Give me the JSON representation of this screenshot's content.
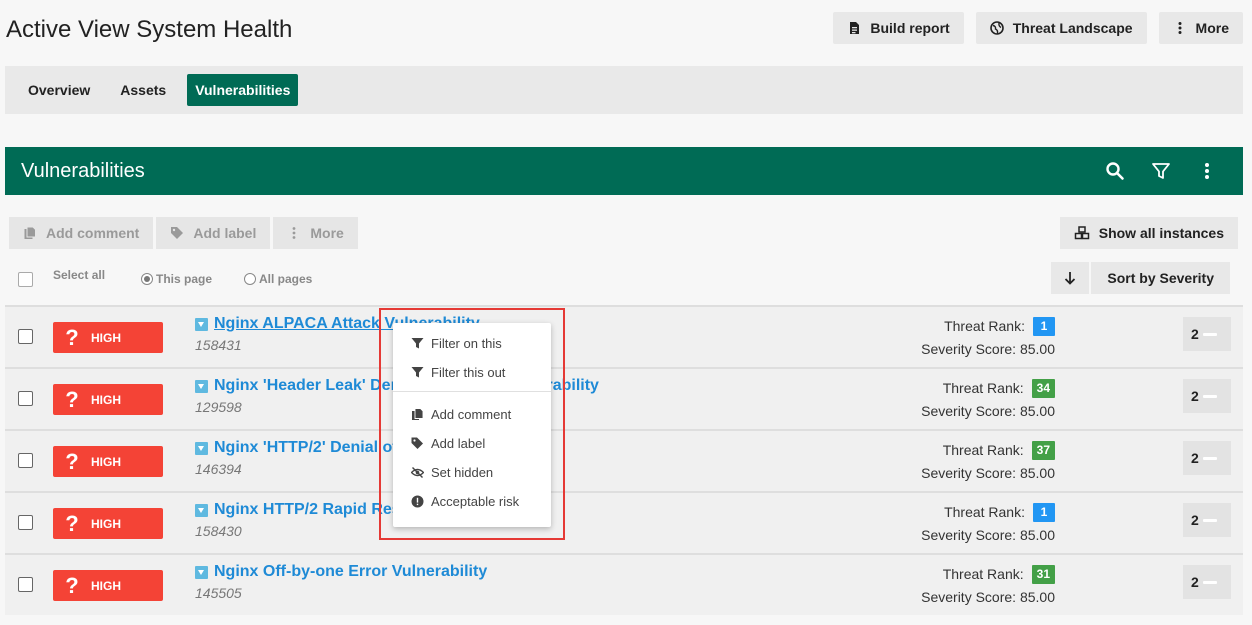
{
  "page": {
    "title": "Active View System Health"
  },
  "top_actions": {
    "build_report": "Build report",
    "threat_landscape": "Threat Landscape",
    "more": "More"
  },
  "tabs": [
    {
      "label": "Overview",
      "active": false
    },
    {
      "label": "Assets",
      "active": false
    },
    {
      "label": "Vulnerabilities",
      "active": true
    }
  ],
  "section": {
    "title": "Vulnerabilities"
  },
  "toolbar": {
    "add_comment": "Add comment",
    "add_label": "Add label",
    "more": "More",
    "show_all": "Show all instances"
  },
  "selection": {
    "select_all": "Select all",
    "this_page": "This page",
    "all_pages": "All pages",
    "this_page_selected": true
  },
  "sort": {
    "label": "Sort by Severity",
    "direction": "descending"
  },
  "labels": {
    "threat_rank": "Threat Rank:",
    "severity_prefix": "Severity Score:"
  },
  "vulnerabilities": [
    {
      "severity": "HIGH",
      "title": "Nginx ALPACA Attack Vulnerability",
      "id": "158431",
      "threat_rank": "1",
      "rank_color": "#2196f3",
      "severity_score": "85.00",
      "count": "2"
    },
    {
      "severity": "HIGH",
      "title": "Nginx 'Header Leak' Denial of Service Vulnerability",
      "id": "129598",
      "threat_rank": "34",
      "rank_color": "#43a047",
      "severity_score": "85.00",
      "count": "2"
    },
    {
      "severity": "HIGH",
      "title": "Nginx 'HTTP/2' Denial of",
      "id": "146394",
      "threat_rank": "37",
      "rank_color": "#43a047",
      "severity_score": "85.00",
      "count": "2"
    },
    {
      "severity": "HIGH",
      "title": "Nginx HTTP/2 Rapid Res",
      "id": "158430",
      "threat_rank": "1",
      "rank_color": "#2196f3",
      "severity_score": "85.00",
      "count": "2"
    },
    {
      "severity": "HIGH",
      "title": "Nginx Off-by-one Error Vulnerability",
      "id": "145505",
      "threat_rank": "31",
      "rank_color": "#43a047",
      "severity_score": "85.00",
      "count": "2"
    }
  ],
  "context_menu": {
    "filter_on": "Filter on this",
    "filter_out": "Filter this out",
    "add_comment": "Add comment",
    "add_label": "Add label",
    "set_hidden": "Set hidden",
    "acceptable_risk": "Acceptable risk"
  },
  "colors": {
    "brand": "#006b55",
    "severity_high": "#f44336",
    "link": "#1e8ad6",
    "highlight": "#e53935"
  }
}
